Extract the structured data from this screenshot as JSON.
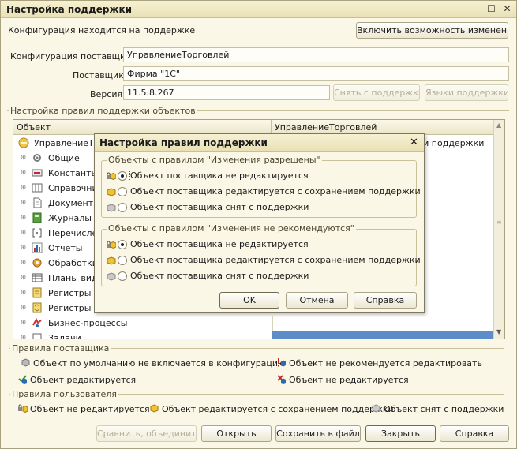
{
  "window": {
    "title": "Настройка поддержки"
  },
  "support_status": "Конфигурация находится на поддержке",
  "enable_changes_button": "Включить возможность изменения",
  "vendor_config": {
    "label": "Конфигурация поставщика:",
    "value": "УправлениеТорговлей"
  },
  "vendor": {
    "label": "Поставщик:",
    "value": "Фирма \"1С\""
  },
  "version": {
    "label": "Версия:",
    "value": "11.5.8.267"
  },
  "remove_support_button": "Снять с поддержки",
  "languages_button": "Языки поддержки",
  "rules_group_title": "Настройка правил поддержки объектов",
  "tree": {
    "col_object": "Объект",
    "col_vendor": "УправлениеТорговлей",
    "rows": [
      {
        "label": "УправлениеТорговлей",
        "value": "м поддержки"
      },
      {
        "label": "Общие"
      },
      {
        "label": "Константы"
      },
      {
        "label": "Справочники"
      },
      {
        "label": "Документы"
      },
      {
        "label": "Журналы д"
      },
      {
        "label": "Перечислен"
      },
      {
        "label": "Отчеты"
      },
      {
        "label": "Обработки"
      },
      {
        "label": "Планы видо"
      },
      {
        "label": "Регистры с"
      },
      {
        "label": "Регистры н"
      },
      {
        "label": "Бизнес-процессы"
      },
      {
        "label": "Задачи"
      }
    ]
  },
  "vendor_rules": {
    "title": "Правила поставщика",
    "not_included": "Объект по умолчанию не включается в конфигурацию",
    "not_recommended": "Объект не рекомендуется редактировать",
    "editable": "Объект редактируется",
    "not_editable": "Объект не редактируется"
  },
  "user_rules": {
    "title": "Правила пользователя",
    "not_edited": "Объект не редактируется",
    "edited_keep": "Объект редактируется с сохранением поддержки",
    "removed": "Объект снят с поддержки"
  },
  "footer": {
    "compare": "Сравнить, объединить",
    "open": "Открыть",
    "save": "Сохранить в файл",
    "close": "Закрыть",
    "help": "Справка"
  },
  "dialog": {
    "title": "Настройка правил поддержки",
    "group1": {
      "title": "Объекты с правилом \"Изменения разрешены\"",
      "options": [
        "Объект поставщика не редактируется",
        "Объект поставщика редактируется с сохранением поддержки",
        "Объект поставщика снят с поддержки"
      ]
    },
    "group2": {
      "title": "Объекты с правилом \"Изменения не рекомендуются\"",
      "options": [
        "Объект поставщика не редактируется",
        "Объект поставщика редактируется с сохранением поддержки",
        "Объект поставщика снят с поддержки"
      ]
    },
    "ok": "OK",
    "cancel": "Отмена",
    "help": "Справка"
  },
  "colors": {
    "accent": "#5d8dc8",
    "window_bg": "#fbf7e6"
  }
}
